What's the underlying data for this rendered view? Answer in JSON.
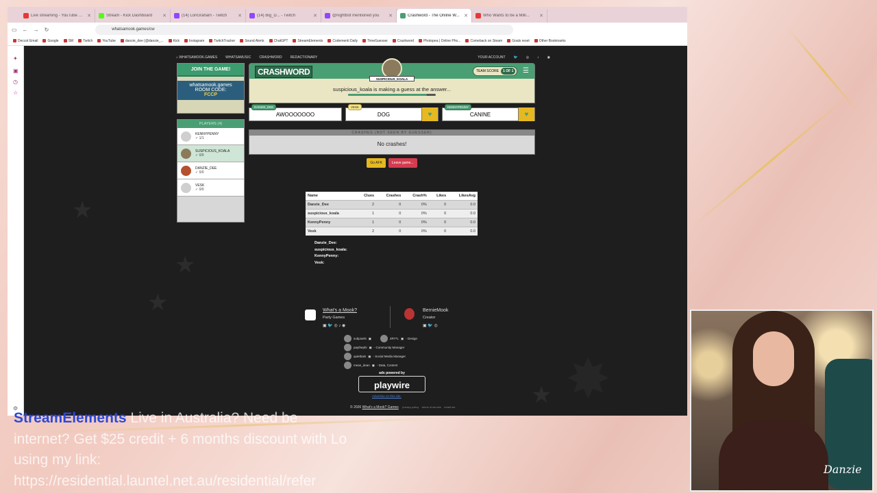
{
  "browser": {
    "tabs": [
      {
        "title": "Live streaming - YouTube Studio",
        "color": "#e53935"
      },
      {
        "title": "Stream - Kick Dashboard",
        "color": "#53fc18"
      },
      {
        "title": "(14) LonGraham - Twitch",
        "color": "#9146ff"
      },
      {
        "title": "(14) Big_D... - Twitch",
        "color": "#9146ff"
      },
      {
        "title": "@nightbot mentioned you",
        "color": "#9146ff"
      },
      {
        "title": "Crashword - The Online W...",
        "color": "#4a9e74"
      },
      {
        "title": "Who Wants to be a Milli...",
        "color": "#e53935"
      }
    ],
    "url": "whatsamook.games/cw",
    "bookmarks": [
      "Deccot Email",
      "Google",
      "SM",
      "Twitch",
      "YouTube",
      "danzie_dee (@danzie_...",
      "Kick",
      "Instagram",
      "TwitchTracker",
      "Sound Alerts",
      "ChatGPT",
      "StreamElements",
      "Codementi Daily",
      "TimeGuesser",
      "Crashword",
      "Photopea | Online Pho...",
      "Comeback on Steam",
      "Goals reset",
      "Other Bookmarks"
    ]
  },
  "site": {
    "nav": [
      "WHATSAMOOK.GAMES",
      "WHATSAMUSIC",
      "CRASHWORD",
      "REDACTIONARY"
    ],
    "account": "YOUR ACCOUNT"
  },
  "join": {
    "title": "JOIN THE GAME!",
    "site": "whatsamook.games",
    "room_label": "ROOM CODE:",
    "room_code": "FCCP"
  },
  "players": {
    "header": "PLAYERS (4)",
    "list": [
      {
        "name": "KENNYPENNY",
        "score": "✓ 1/1"
      },
      {
        "name": "SUSPICIOUS_KOALA",
        "score": "✓ 0/0"
      },
      {
        "name": "DANZIE_DEE",
        "score": "✓ 0/0"
      },
      {
        "name": "VESK",
        "score": "✓ 0/0"
      }
    ]
  },
  "game": {
    "logo": "CRASHWORD",
    "guesser": "SUSPICIOUS_KOALA",
    "team_score_label": "TEAM SCORE",
    "team_score": "1 OF 1",
    "status": "suspicious_koala is making a guess at the answer...",
    "progress": 0.9,
    "clues": [
      {
        "player": "DANZIE_DEE",
        "word": "AWOOOOOOO"
      },
      {
        "player": "VESK",
        "word": "DOG"
      },
      {
        "player": "KENNYPENNY",
        "word": "CANINE"
      }
    ],
    "crashes_header": "CRASHES (NOT SEEN BY GUESSER)",
    "crashes_text": "No crashes!",
    "afk_button": "Go AFK",
    "leave_button": "Leave game..."
  },
  "stats": {
    "headers": [
      "Name",
      "Clues",
      "Crashes",
      "Crash%",
      "Likes",
      "LikesAvg"
    ],
    "rows": [
      [
        "Danzie_Dee",
        "2",
        "0",
        "0%",
        "0",
        "0.0"
      ],
      [
        "suspicious_koala",
        "1",
        "0",
        "0%",
        "0",
        "0.0"
      ],
      [
        "KennyPenny",
        "1",
        "0",
        "0%",
        "0",
        "0.0"
      ],
      [
        "Vesk",
        "2",
        "0",
        "0%",
        "0",
        "0.0"
      ]
    ]
  },
  "player_list": [
    "Danzie_Dee:",
    "suspicious_koala:",
    "KennyPenny:",
    "Vesk:"
  ],
  "footer": {
    "brand": "What's a Mook?",
    "brand_sub": "Party Games",
    "creator": "BernieMook",
    "creator_role": "Creator",
    "team": [
      {
        "name": "subpixels",
        "role": ""
      },
      {
        "name": "4RY*L",
        "role": "- Design"
      },
      {
        "name": "paythephi",
        "role": "- Community Manager"
      },
      {
        "name": "quietbats",
        "role": "- Social Media Manager"
      },
      {
        "name": "mean_dean",
        "role": "- Data, Content"
      }
    ],
    "ads": "ads powered by",
    "ads_brand": "playwire",
    "advertise": "Advertise on this site.",
    "copyright": "© 2026",
    "copyright_link": "What's a Mook? Games",
    "links": [
      "privacy policy",
      "terms of service",
      "email me"
    ]
  },
  "overlay": {
    "brand": "StreamElements",
    "message": "Live in Australia? Need be\ninternet? Get $25 credit + 6 months discount with Lo\nusing my link:\nhttps://residential.launtel.net.au/residential/refer"
  },
  "watermark": "Danzie"
}
